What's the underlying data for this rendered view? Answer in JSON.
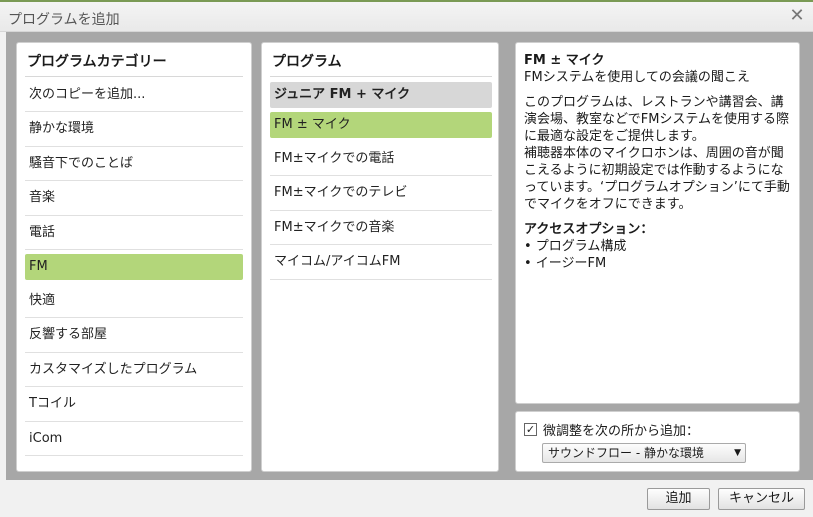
{
  "window": {
    "title": "プログラムを追加",
    "close_glyph": "✕"
  },
  "categories": {
    "header": "プログラムカテゴリー",
    "items": [
      "次のコピーを追加...",
      "静かな環境",
      "騒音下でのことば",
      "音楽",
      "電話",
      "FM",
      "快適",
      "反響する部屋",
      "カスタマイズしたプログラム",
      "Tコイル",
      "iCom"
    ],
    "selected_index": 5
  },
  "programs": {
    "header": "プログラム",
    "items": [
      "ジュニア FM + マイク",
      "FM ± マイク",
      "FM±マイクでの電話",
      "FM±マイクでのテレビ",
      "FM±マイクでの音楽",
      "マイコム/アイコムFM"
    ],
    "highlight_index": 0,
    "selected_index": 1
  },
  "description": {
    "title": "FM ± マイク",
    "subtitle": "FMシステムを使用しての会議の聞こえ",
    "para1": "このプログラムは、レストランや講習会、講演会場、教室などでFMシステムを使用する際に最適な設定をご提供します。",
    "para2": "補聴器本体のマイクロホンは、周囲の音が聞こえるように初期設定では作動するようになっています。‘プログラムオプション’にて手動でマイクをオフにできます。",
    "access_heading": "アクセスオプション：",
    "access_items": [
      "• プログラム構成",
      "• イージーFM"
    ]
  },
  "finetune": {
    "checkbox_label": "微調整を次の所から追加：",
    "checked_glyph": "✓",
    "select_value": "サウンドフロー - 静かな環境",
    "arrow_glyph": "▼"
  },
  "buttons": {
    "add": "追加",
    "cancel": "キャンセル"
  }
}
